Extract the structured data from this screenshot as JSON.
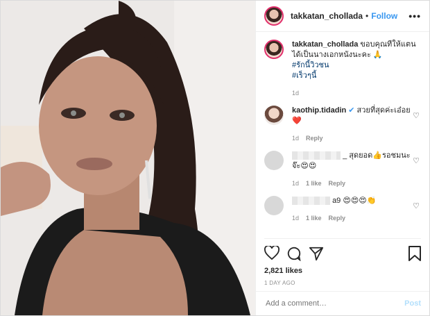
{
  "header": {
    "username": "takkatan_chollada",
    "separator": "•",
    "follow_label": "Follow",
    "more_icon": "ellipsis-icon"
  },
  "caption": {
    "username": "takkatan_chollada",
    "text": "ขอบคุณที่ให้แตนได้เป็นนางเอกหนังนะคะ 🙏",
    "tags": [
      "#รักนี้วิวชน",
      "#เร็วๆนี้"
    ],
    "time": "1d"
  },
  "comments": [
    {
      "username": "kaothip.tidadin",
      "verified": true,
      "text": "สวยที่สุดค่ะเอ๋อย❤️",
      "time": "1d",
      "likes": "",
      "reply": "Reply"
    },
    {
      "username": "",
      "text": "_ สุดยอด👍รอชมนะจ๊ะ😍😍",
      "time": "1d",
      "likes": "1 like",
      "reply": "Reply"
    },
    {
      "username": "",
      "text": "a9 😍😍😍👏",
      "time": "1d",
      "likes": "1 like",
      "reply": "Reply"
    }
  ],
  "likes": "2,821 likes",
  "posted_ago": "1 DAY AGO",
  "comment_box": {
    "placeholder": "Add a comment…",
    "post_label": "Post"
  }
}
